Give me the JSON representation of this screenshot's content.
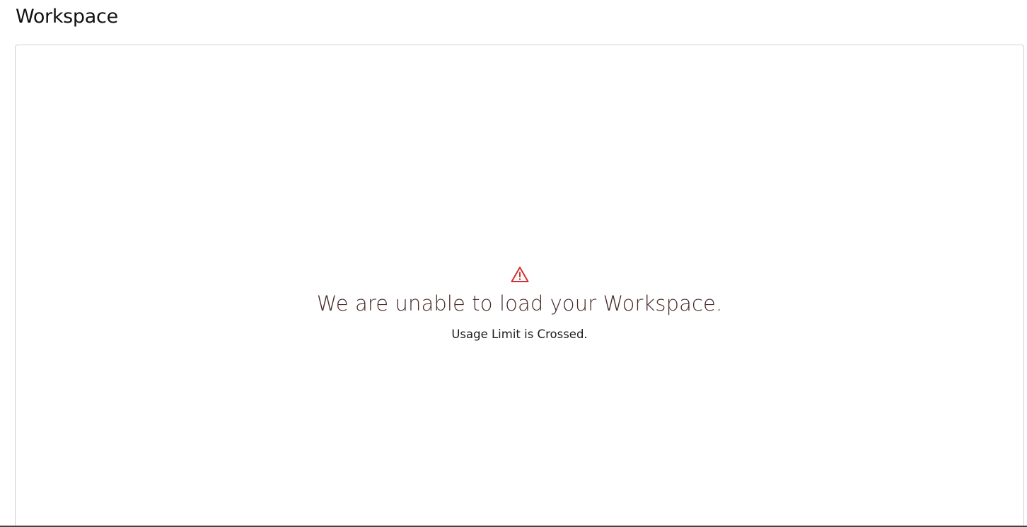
{
  "page": {
    "title": "Workspace"
  },
  "error": {
    "icon": "warning-triangle-icon",
    "icon_color": "#d32f2f",
    "heading": "We are unable to load your Workspace.",
    "detail": "Usage Limit is Crossed."
  }
}
